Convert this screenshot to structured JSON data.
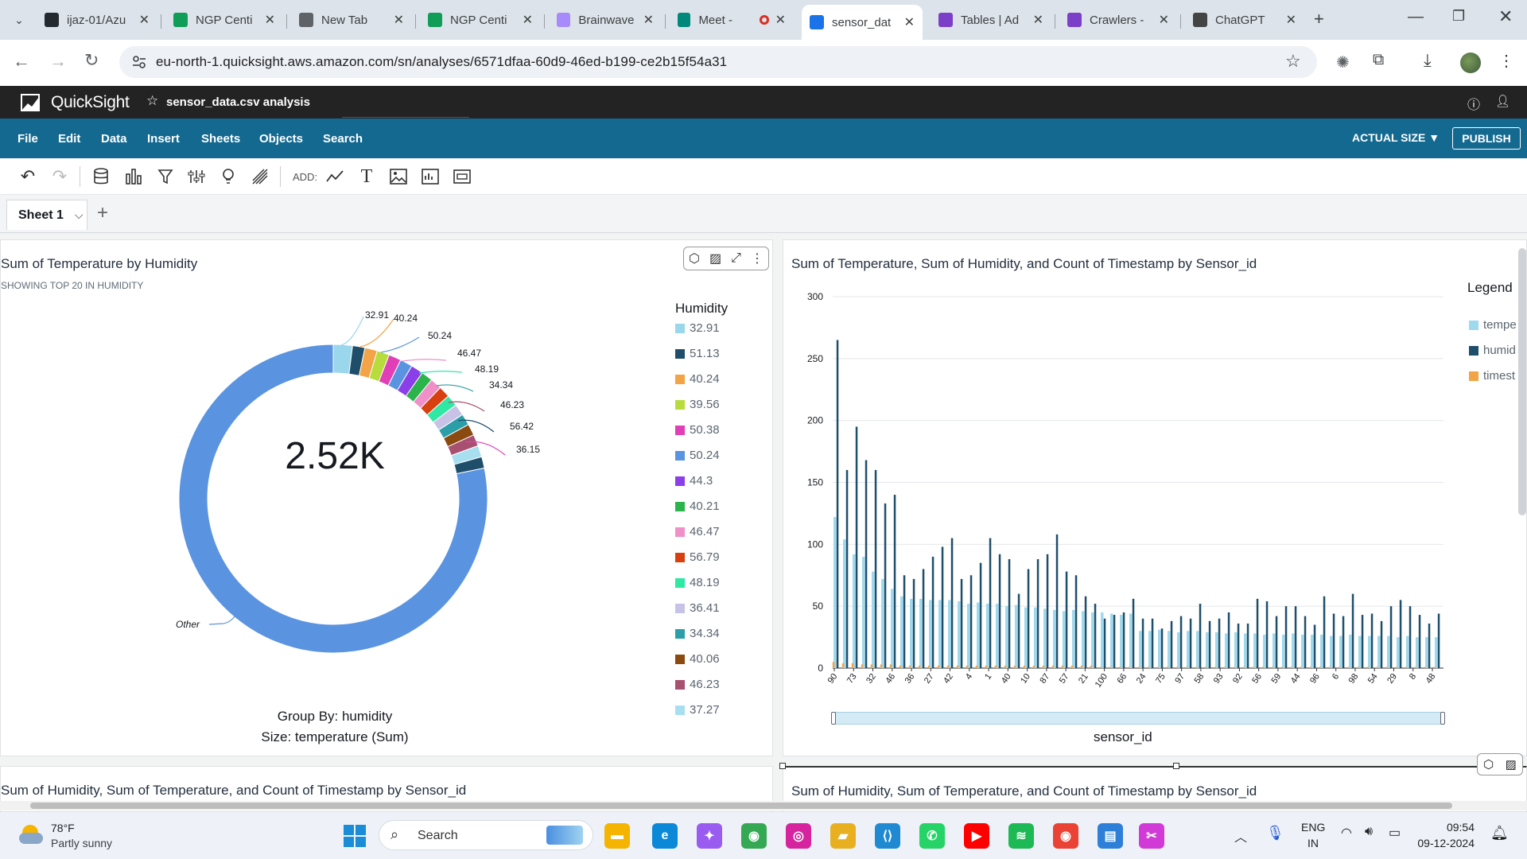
{
  "browser": {
    "tabs": [
      {
        "title": "ijaz-01/Azu",
        "icon": "github-icon",
        "color": "#24292f"
      },
      {
        "title": "NGP Centi",
        "icon": "sheets-icon",
        "color": "#0f9d58"
      },
      {
        "title": "New Tab",
        "icon": "chrome-icon",
        "color": "#5f6368"
      },
      {
        "title": "NGP Centi",
        "icon": "sheets-icon",
        "color": "#0f9d58"
      },
      {
        "title": "Brainwave",
        "icon": "brainwave-icon",
        "color": "#a78bfa"
      },
      {
        "title": "Meet -",
        "icon": "meet-icon",
        "color": "#00897b"
      },
      {
        "title": "sensor_dat",
        "icon": "quicksight-icon",
        "color": "#1a73e8"
      },
      {
        "title": "Tables | Ad",
        "icon": "aws-icon",
        "color": "#7b3fc8"
      },
      {
        "title": "Crawlers -",
        "icon": "aws-icon",
        "color": "#7b3fc8"
      },
      {
        "title": "ChatGPT",
        "icon": "openai-icon",
        "color": "#444"
      }
    ],
    "url": "eu-north-1.quicksight.aws.amazon.com/sn/analyses/6571dfaa-60d9-46ed-b199-ce2b15f54a31"
  },
  "app": {
    "brand": "QuickSight",
    "analysis_name": "sensor_data.csv analysis",
    "menu": [
      "File",
      "Edit",
      "Data",
      "Insert",
      "Sheets",
      "Objects",
      "Search"
    ],
    "size_label": "ACTUAL SIZE",
    "publish_label": "PUBLISH",
    "add_label": "ADD:",
    "sheet_tab": "Sheet 1"
  },
  "donut": {
    "title": "Sum of Temperature by Humidity",
    "subtitle": "SHOWING TOP 20 IN HUMIDITY",
    "center_value": "2.52K",
    "group_by": "Group By: humidity",
    "size_by": "Size: temperature (Sum)",
    "legend_title": "Humidity",
    "callouts": [
      "32.91",
      "40.24",
      "50.24",
      "46.47",
      "48.19",
      "34.34",
      "46.23",
      "56.42",
      "36.15",
      "Other"
    ],
    "legend": [
      {
        "label": "32.91",
        "color": "#9ad6ec"
      },
      {
        "label": "51.13",
        "color": "#1f4e6b"
      },
      {
        "label": "40.24",
        "color": "#f2a447"
      },
      {
        "label": "39.56",
        "color": "#b7dc3c"
      },
      {
        "label": "50.38",
        "color": "#e03fb5"
      },
      {
        "label": "50.24",
        "color": "#5a94e0"
      },
      {
        "label": "44.3",
        "color": "#8b3fe8"
      },
      {
        "label": "40.21",
        "color": "#2bb34c"
      },
      {
        "label": "46.47",
        "color": "#f08fc8"
      },
      {
        "label": "56.79",
        "color": "#d8400f"
      },
      {
        "label": "48.19",
        "color": "#2ee8a4"
      },
      {
        "label": "36.41",
        "color": "#c6c3e6"
      },
      {
        "label": "34.34",
        "color": "#2c9ea8"
      },
      {
        "label": "40.06",
        "color": "#8a4a10"
      },
      {
        "label": "46.23",
        "color": "#a85070"
      },
      {
        "label": "37.27",
        "color": "#a8dff0"
      }
    ]
  },
  "chart_data": [
    {
      "type": "pie",
      "title": "Sum of Temperature by Humidity",
      "center_total": "2.52K",
      "slices": [
        {
          "label": "32.91",
          "value": 2.0
        },
        {
          "label": "51.13",
          "value": 1.3
        },
        {
          "label": "40.24",
          "value": 1.3
        },
        {
          "label": "39.56",
          "value": 1.3
        },
        {
          "label": "50.38",
          "value": 1.3
        },
        {
          "label": "50.24",
          "value": 1.3
        },
        {
          "label": "44.3",
          "value": 1.3
        },
        {
          "label": "40.21",
          "value": 1.2
        },
        {
          "label": "46.47",
          "value": 1.2
        },
        {
          "label": "56.79",
          "value": 1.2
        },
        {
          "label": "48.19",
          "value": 1.2
        },
        {
          "label": "36.41",
          "value": 1.2
        },
        {
          "label": "34.34",
          "value": 1.2
        },
        {
          "label": "40.06",
          "value": 1.2
        },
        {
          "label": "46.23",
          "value": 1.2
        },
        {
          "label": "37.27",
          "value": 1.2
        },
        {
          "label": "56.42",
          "value": 1.2
        },
        {
          "label": "Other",
          "value": 78.1
        }
      ]
    },
    {
      "type": "bar",
      "title": "Sum of Temperature, Sum of Humidity, and Count of Timestamp by Sensor_id",
      "xlabel": "sensor_id",
      "legend_title": "Legend",
      "legend": [
        "tempe",
        "humid",
        "timest"
      ],
      "ylim": [
        0,
        300
      ],
      "yticks": [
        0,
        50,
        100,
        150,
        200,
        250,
        300
      ],
      "xtick_labels": [
        "90",
        "73",
        "32",
        "46",
        "36",
        "27",
        "42",
        "4",
        "1",
        "40",
        "10",
        "87",
        "57",
        "21",
        "100",
        "66",
        "24",
        "75",
        "97",
        "58",
        "93",
        "92",
        "56",
        "59",
        "44",
        "96",
        "6",
        "98",
        "54",
        "29",
        "8",
        "48"
      ],
      "series": [
        {
          "name": "tempe",
          "color": "#9fd9ee",
          "values": [
            122,
            104,
            92,
            90,
            78,
            72,
            64,
            58,
            56,
            56,
            55,
            55,
            55,
            54,
            52,
            53,
            52,
            52,
            50,
            51,
            49,
            49,
            48,
            47,
            46,
            47,
            46,
            45,
            45,
            44,
            43,
            44,
            30,
            30,
            31,
            30,
            29,
            30,
            30,
            29,
            29,
            28,
            29,
            28,
            28,
            27,
            28,
            27,
            28,
            27,
            27,
            27,
            26,
            26,
            27,
            26,
            26,
            26,
            26,
            25,
            26,
            25,
            25,
            25
          ]
        },
        {
          "name": "humid",
          "color": "#1f4e6b",
          "values": [
            265,
            160,
            195,
            168,
            160,
            133,
            140,
            75,
            72,
            80,
            90,
            98,
            105,
            72,
            75,
            85,
            105,
            92,
            88,
            60,
            80,
            88,
            92,
            108,
            78,
            75,
            58,
            52,
            40,
            43,
            45,
            56,
            40,
            40,
            32,
            38,
            42,
            40,
            52,
            38,
            40,
            45,
            36,
            36,
            56,
            54,
            42,
            50,
            50,
            42,
            35,
            58,
            44,
            42,
            60,
            43,
            44,
            38,
            50,
            55,
            50,
            43,
            36,
            44
          ]
        },
        {
          "name": "timest",
          "color": "#f2a447",
          "values": [
            5,
            4,
            4,
            3,
            3,
            3,
            3,
            2,
            2,
            2,
            2,
            2,
            2,
            2,
            2,
            2,
            2,
            2,
            2,
            2,
            2,
            2,
            2,
            2,
            2,
            2,
            2,
            2,
            1,
            1,
            1,
            1,
            1,
            1,
            1,
            1,
            1,
            1,
            1,
            1,
            1,
            1,
            1,
            1,
            1,
            1,
            1,
            1,
            1,
            1,
            1,
            1,
            1,
            1,
            1,
            1,
            1,
            1,
            1,
            1,
            1,
            1,
            1,
            1
          ]
        }
      ]
    }
  ],
  "bottom_panels": {
    "left_title": "Sum of Humidity, Sum of Temperature, and Count of Timestamp by Sensor_id",
    "right_title": "Sum of Humidity, Sum of Temperature, and Count of Timestamp by Sensor_id"
  },
  "taskbar": {
    "weather_temp": "78°F",
    "weather_desc": "Partly sunny",
    "search_label": "Search",
    "lang_top": "ENG",
    "lang_bottom": "IN",
    "time": "09:54",
    "date": "09-12-2024",
    "apps": [
      {
        "name": "file-explorer-app",
        "color": "#f4b400"
      },
      {
        "name": "edge-app",
        "color": "#0c88d8"
      },
      {
        "name": "copilot-app",
        "color": "#9a5cf0"
      },
      {
        "name": "chrome-app",
        "color": "#34a853"
      },
      {
        "name": "instagram-app",
        "color": "#d6249f"
      },
      {
        "name": "folder-app",
        "color": "#e8b020"
      },
      {
        "name": "vscode-app",
        "color": "#1f8ad2"
      },
      {
        "name": "whatsapp-app",
        "color": "#25d366"
      },
      {
        "name": "youtube-app",
        "color": "#ff0000"
      },
      {
        "name": "spotify-app",
        "color": "#1db954"
      },
      {
        "name": "chrome-profile-app",
        "color": "#ea4335"
      },
      {
        "name": "notepad-app",
        "color": "#2d7fd8"
      },
      {
        "name": "snipping-app",
        "color": "#d13ad6"
      }
    ]
  }
}
